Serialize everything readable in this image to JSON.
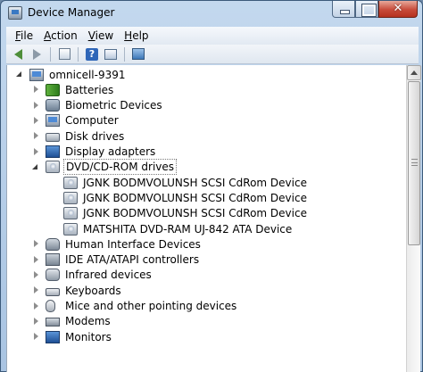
{
  "window": {
    "title": "Device Manager",
    "close_glyph": "✕"
  },
  "menu": [
    {
      "label": "File",
      "accel": "F",
      "rest": "ile"
    },
    {
      "label": "Action",
      "accel": "A",
      "rest": "ction"
    },
    {
      "label": "View",
      "accel": "V",
      "rest": "iew"
    },
    {
      "label": "Help",
      "accel": "H",
      "rest": "elp"
    }
  ],
  "toolbar": {
    "help_glyph": "?"
  },
  "tree": {
    "root": {
      "label": "omnicell-9391",
      "icon": "computer-icon",
      "state": "expanded"
    },
    "nodes": [
      {
        "label": "Batteries",
        "icon": "battery-icon",
        "state": "collapsed",
        "level": 1
      },
      {
        "label": "Biometric Devices",
        "icon": "fingerprint-icon",
        "state": "collapsed",
        "level": 1
      },
      {
        "label": "Computer",
        "icon": "computer-icon",
        "state": "collapsed",
        "level": 1
      },
      {
        "label": "Disk drives",
        "icon": "disk-drive-icon",
        "state": "collapsed",
        "level": 1
      },
      {
        "label": "Display adapters",
        "icon": "display-adapter-icon",
        "state": "collapsed",
        "level": 1
      },
      {
        "label": "DVD/CD-ROM drives",
        "icon": "dvd-drive-icon",
        "state": "expanded",
        "level": 1,
        "selected": true
      },
      {
        "label": "JGNK BODMVOLUNSH SCSI CdRom Device",
        "icon": "dvd-drive-icon",
        "state": "none",
        "level": 2
      },
      {
        "label": "JGNK BODMVOLUNSH SCSI CdRom Device",
        "icon": "dvd-drive-icon",
        "state": "none",
        "level": 2
      },
      {
        "label": "JGNK BODMVOLUNSH SCSI CdRom Device",
        "icon": "dvd-drive-icon",
        "state": "none",
        "level": 2
      },
      {
        "label": "MATSHITA DVD-RAM UJ-842 ATA Device",
        "icon": "dvd-drive-icon",
        "state": "none",
        "level": 2
      },
      {
        "label": "Human Interface Devices",
        "icon": "hid-icon",
        "state": "collapsed",
        "level": 1
      },
      {
        "label": "IDE ATA/ATAPI controllers",
        "icon": "ide-controller-icon",
        "state": "collapsed",
        "level": 1
      },
      {
        "label": "Infrared devices",
        "icon": "infrared-icon",
        "state": "collapsed",
        "level": 1
      },
      {
        "label": "Keyboards",
        "icon": "keyboard-icon",
        "state": "collapsed",
        "level": 1
      },
      {
        "label": "Mice and other pointing devices",
        "icon": "mouse-icon",
        "state": "collapsed",
        "level": 1
      },
      {
        "label": "Modems",
        "icon": "modem-icon",
        "state": "collapsed",
        "level": 1
      },
      {
        "label": "Monitors",
        "icon": "monitor-icon",
        "state": "collapsed",
        "level": 1
      }
    ]
  }
}
